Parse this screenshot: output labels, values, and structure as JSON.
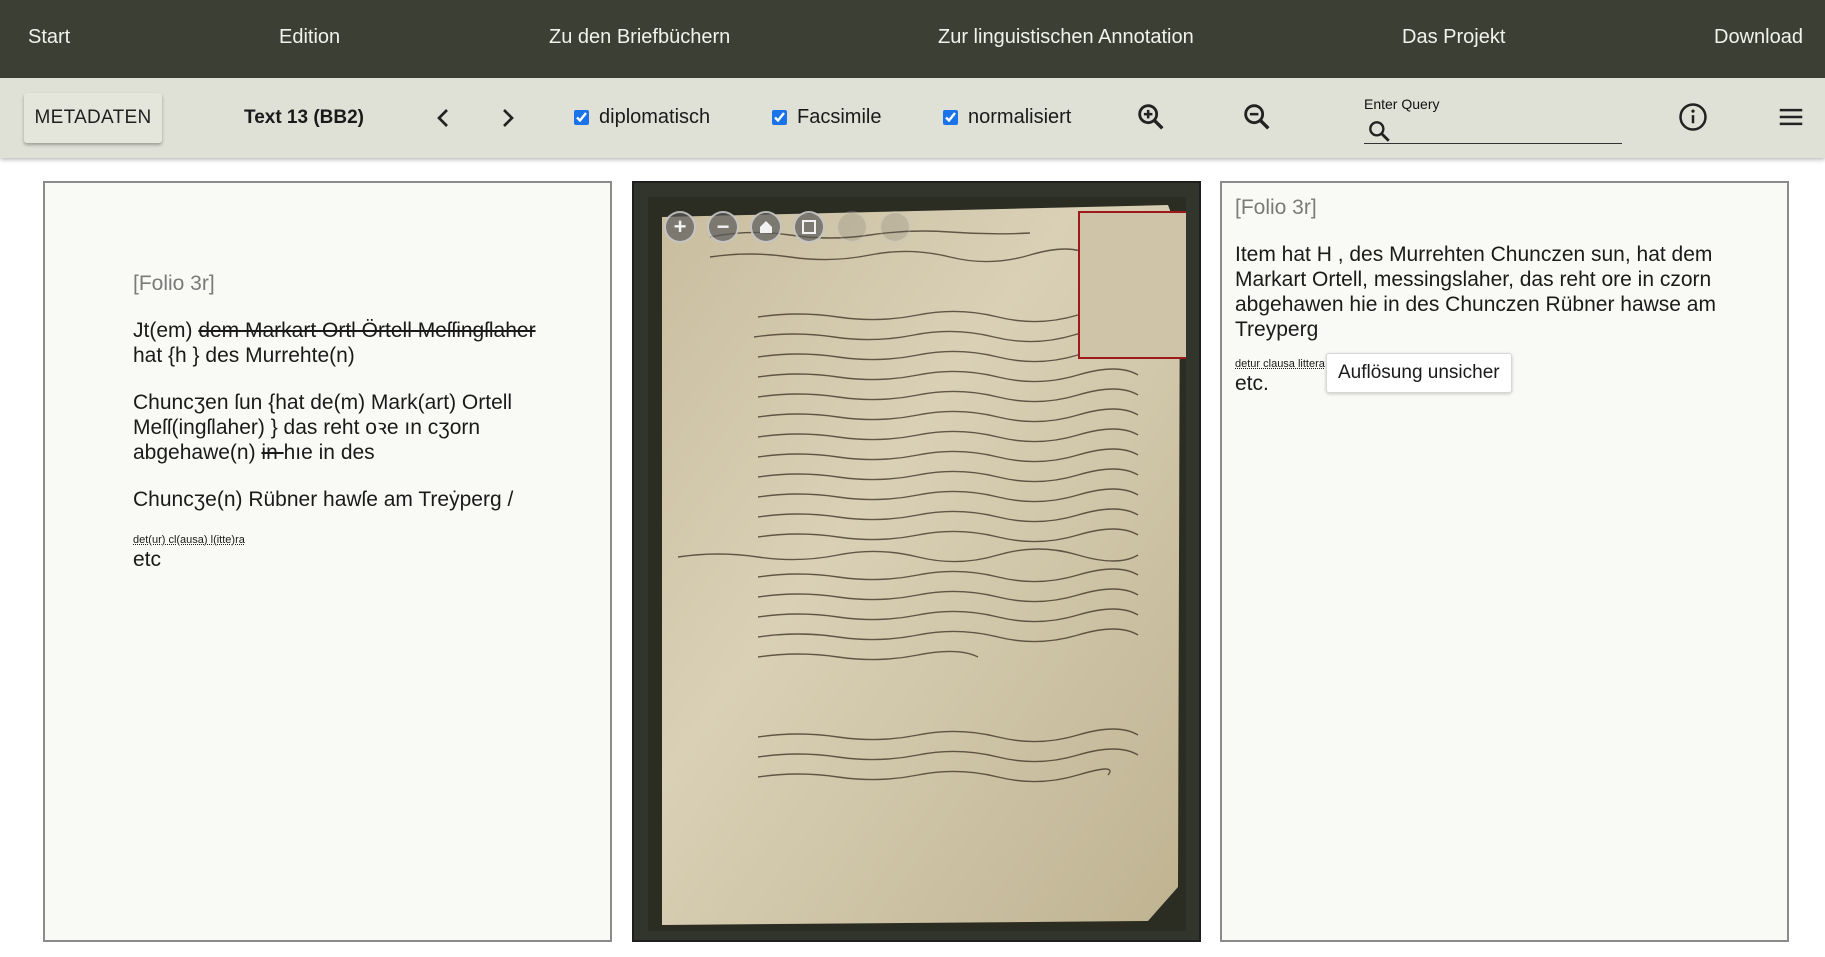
{
  "nav": {
    "items": [
      "Start",
      "Edition",
      "Zu den Briefbüchern",
      "Zur linguistischen Annotation",
      "Das Projekt",
      "Download"
    ]
  },
  "toolbar": {
    "metadata_button": "METADATEN",
    "text_title": "Text 13 (BB2)",
    "checkboxes": [
      {
        "label": "diplomatisch",
        "checked": true
      },
      {
        "label": "Facsimile",
        "checked": true
      },
      {
        "label": "normalisiert",
        "checked": true
      }
    ],
    "query_label": "Enter Query",
    "query_value": ""
  },
  "diplomatic": {
    "folio": "[Folio 3r]",
    "p1_a": "Jt(em) ",
    "p1_del": "dem Markart Ortl Örtell Meſſingſlaher ",
    "p1_b": "hat {h } des Murrehte(n)",
    "p2_a": "Chuncʒen ſun {hat de(m) Mark(art) Ortell Meſſ(ingſlaher) } das reht oꝛe ın cʒorn abgehawe(n) ",
    "p2_del": "in ",
    "p2_b": "hıe in des",
    "p3": "Chuncʒe(n) Rübner hawſe am Treẏperg /",
    "abbr": "det(ur) cl(ausa) l(itte)ra",
    "end": "etc"
  },
  "normalized": {
    "folio": "[Folio 3r]",
    "text": "Item hat H , des Murrehten Chunczen sun, hat dem Markart Ortell, messingslaher, das reht ore in czorn abgehawen hie in des Chunczen Rübner hawse am Treyperg",
    "abbr": "detur clausa littera",
    "tooltip": "Auflösung unsicher",
    "end": "etc."
  },
  "viewer": {
    "controls": [
      "zoom-in",
      "zoom-out",
      "home",
      "fullscreen",
      "rotate-left",
      "rotate-right"
    ]
  }
}
